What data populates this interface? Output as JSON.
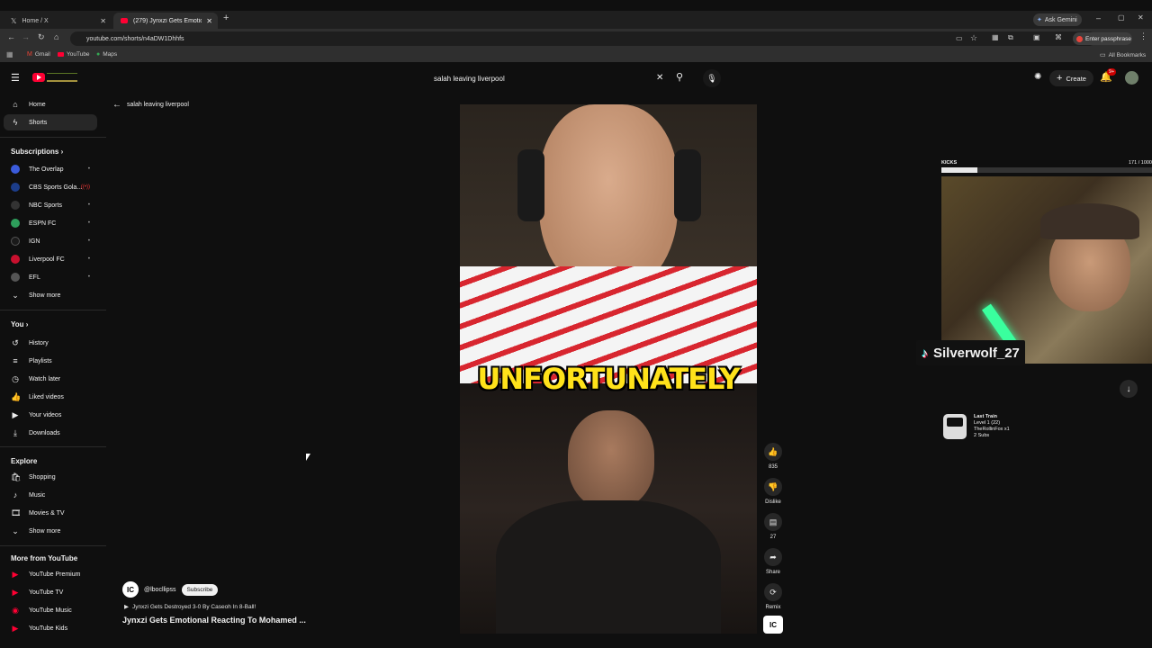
{
  "browser": {
    "tabs": [
      {
        "label": "Home / X",
        "icon": "x-logo-icon"
      },
      {
        "label": "(279) Jynxzi Gets Emotional",
        "icon": "youtube-icon"
      }
    ],
    "url": "youtube.com/shorts/n4aDW1Dhhfs",
    "ask_gemini": "Ask Gemini",
    "passphrase": "Enter passphrase",
    "bookmarks": [
      "Gmail",
      "YouTube",
      "Maps"
    ],
    "all_bookmarks": "All Bookmarks"
  },
  "header": {
    "search_value": "salah leaving liverpool",
    "create_label": "Create",
    "notification_count": "9+"
  },
  "breadcrumb": "salah leaving liverpool",
  "sidebar": {
    "main": [
      {
        "label": "Home",
        "icon": "home-icon"
      },
      {
        "label": "Shorts",
        "icon": "shorts-icon"
      }
    ],
    "subscriptions_title": "Subscriptions",
    "subscriptions": [
      {
        "label": "The Overlap",
        "color": "#3b5bdb",
        "badge": "•"
      },
      {
        "label": "CBS Sports Gola...",
        "color": "#1c3d8a",
        "badge": "((•))"
      },
      {
        "label": "NBC Sports",
        "color": "#333333",
        "badge": "•"
      },
      {
        "label": "ESPN FC",
        "color": "#2e9e5b",
        "badge": "•"
      },
      {
        "label": "IGN",
        "color": "#1a1a1a",
        "badge": "•"
      },
      {
        "label": "Liverpool FC",
        "color": "#c8102e",
        "badge": "•"
      },
      {
        "label": "EFL",
        "color": "#555555",
        "badge": "•"
      }
    ],
    "show_more": "Show more",
    "you_title": "You",
    "you": [
      {
        "label": "History",
        "icon": "history-icon"
      },
      {
        "label": "Playlists",
        "icon": "playlists-icon"
      },
      {
        "label": "Watch later",
        "icon": "clock-icon"
      },
      {
        "label": "Liked videos",
        "icon": "thumbs-up-icon"
      },
      {
        "label": "Your videos",
        "icon": "video-icon"
      },
      {
        "label": "Downloads",
        "icon": "download-icon"
      }
    ],
    "explore_title": "Explore",
    "explore": [
      {
        "label": "Shopping",
        "icon": "bag-icon"
      },
      {
        "label": "Music",
        "icon": "music-icon"
      },
      {
        "label": "Movies & TV",
        "icon": "film-icon"
      }
    ],
    "show_more_2": "Show more",
    "more_title": "More from YouTube",
    "more": [
      {
        "label": "YouTube Premium"
      },
      {
        "label": "YouTube TV"
      },
      {
        "label": "YouTube Music"
      },
      {
        "label": "YouTube Kids"
      }
    ]
  },
  "short": {
    "caption": "UNFORTUNATELY",
    "channel": "@lbocllipss",
    "subscribe": "Subscribe",
    "related": "Jynxzi Gets Destroyed 3-0 By Caseoh In 8-Ball!",
    "title": "Jynxzi Gets Emotional Reacting To Mohamed ..."
  },
  "actions": [
    {
      "icon": "thumbs-up-icon",
      "label": "835"
    },
    {
      "icon": "thumbs-down-icon",
      "label": "Dislike"
    },
    {
      "icon": "comment-icon",
      "label": "27"
    },
    {
      "icon": "share-icon",
      "label": "Share"
    },
    {
      "icon": "remix-icon",
      "label": "Remix"
    }
  ],
  "stream_overlay": {
    "kicks_label": "KICKS",
    "kicks_count": "171 / 1000",
    "kicks_progress": 0.171,
    "username": "Silverwolf_27",
    "info_lines": [
      "Last Train",
      "Level 1 (22)",
      "TheRollinFox x1",
      "2 Subs"
    ]
  }
}
